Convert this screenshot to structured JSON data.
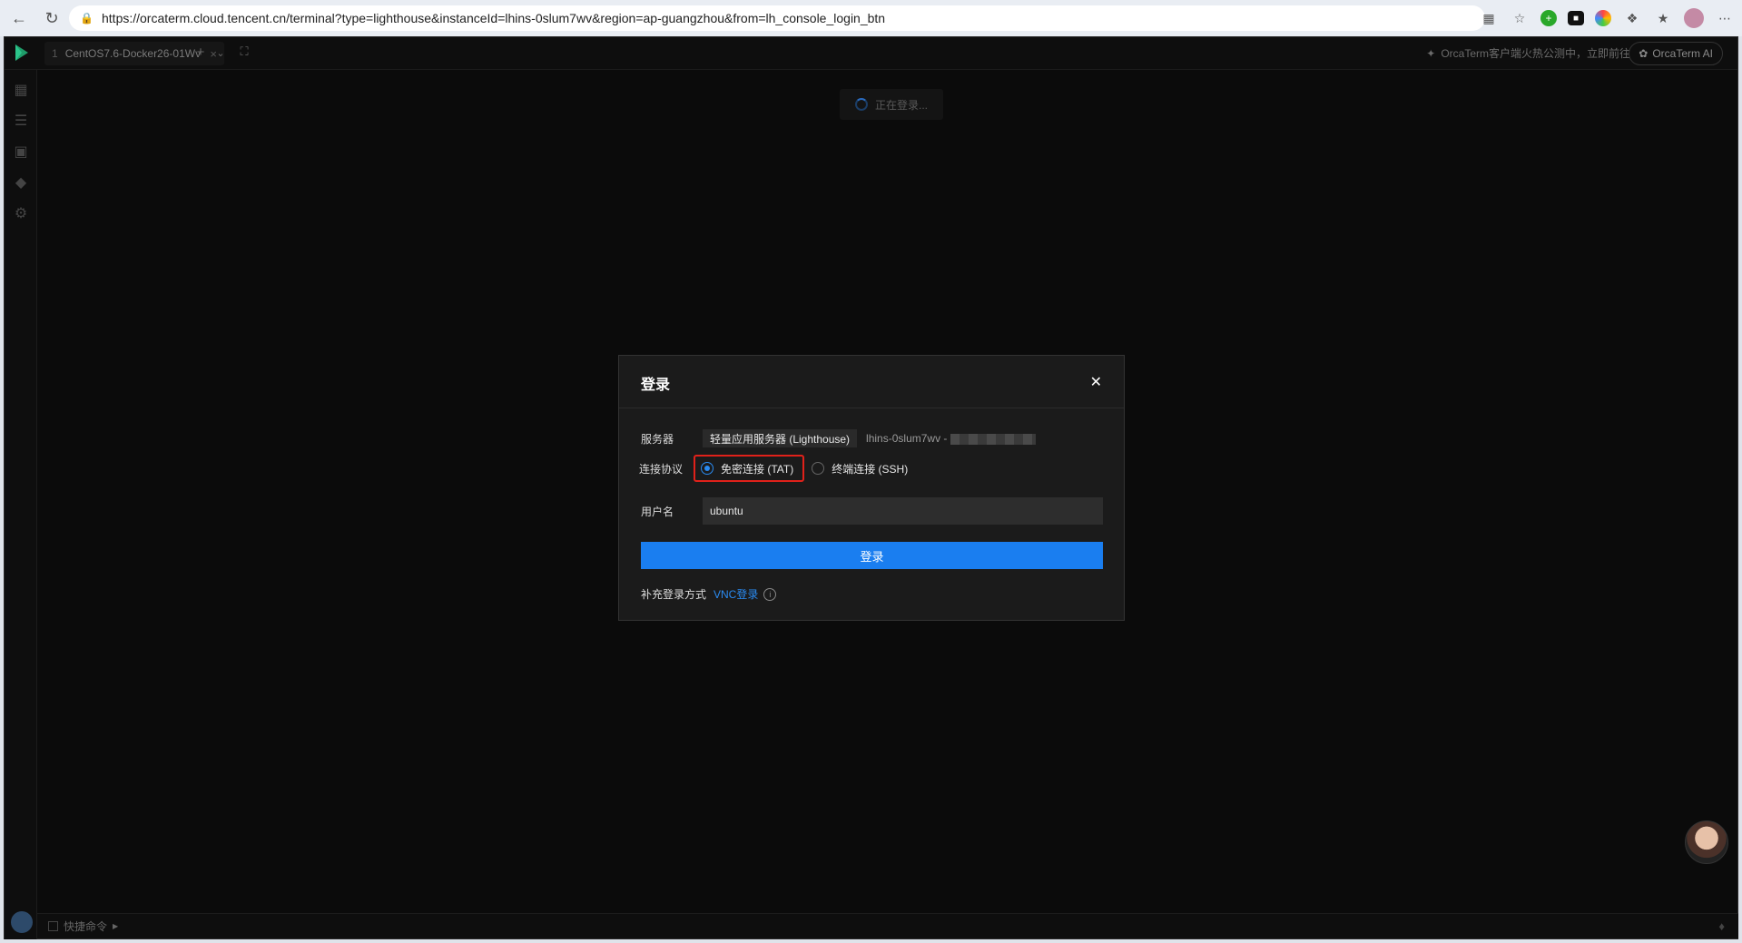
{
  "browser": {
    "url": "https://orcaterm.cloud.tencent.cn/terminal?type=lighthouse&instanceId=lhins-0slum7wv&region=ap-guangzhou&from=lh_console_login_btn"
  },
  "app": {
    "tab": {
      "number": "1",
      "title": "CentOS7.6-Docker26-01Wv"
    },
    "promo_text": "OrcaTerm客户端火热公测中，立即前往",
    "ai_button": "OrcaTerm AI",
    "loading_text": "正在登录...",
    "bottom_bar": {
      "shortcut_label": "快捷命令"
    }
  },
  "dialog": {
    "title": "登录",
    "server_label": "服务器",
    "server_type": "轻量应用服务器 (Lighthouse)",
    "instance_id": "lhins-0slum7wv -",
    "protocol_label": "连接协议",
    "protocol_options": [
      {
        "label": "免密连接 (TAT)",
        "selected": true
      },
      {
        "label": "终端连接 (SSH)",
        "selected": false
      }
    ],
    "username_label": "用户名",
    "username_value": "ubuntu",
    "login_button": "登录",
    "alt_login_label": "补充登录方式",
    "vnc_link": "VNC登录"
  },
  "colors": {
    "primary": "#1a7ef0",
    "highlight_border": "#e0211a",
    "background": "#0b0b0b"
  }
}
